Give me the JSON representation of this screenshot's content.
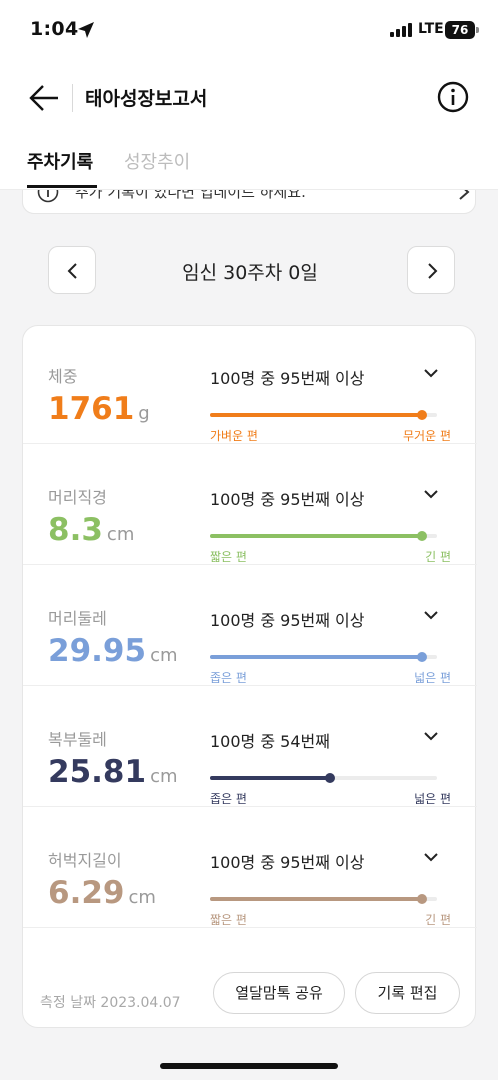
{
  "status_bar": {
    "time": "1:04",
    "network": "LTE",
    "battery": "76"
  },
  "header": {
    "title": "태아성장보고서"
  },
  "tabs": [
    {
      "label": "주차기록",
      "active": true
    },
    {
      "label": "성장추이",
      "active": false
    }
  ],
  "notice": {
    "text": "추가 기록이 있다면 업데이트 하세요."
  },
  "week_nav": {
    "label": "임신 30주차 0일"
  },
  "metrics": [
    {
      "name": "체중",
      "value": "1761",
      "unit": "g",
      "rank": "100명 중 95번째 이상",
      "percentile": 95,
      "color": "#f07d1a",
      "low_label": "가벼운 편",
      "high_label": "무거운 편"
    },
    {
      "name": "머리직경",
      "value": "8.3",
      "unit": "cm",
      "rank": "100명 중 95번째 이상",
      "percentile": 95,
      "color": "#8cc063",
      "low_label": "짧은 편",
      "high_label": "긴 편"
    },
    {
      "name": "머리둘레",
      "value": "29.95",
      "unit": "cm",
      "rank": "100명 중 95번째 이상",
      "percentile": 95,
      "color": "#7a9fd9",
      "low_label": "좁은 편",
      "high_label": "넓은 편"
    },
    {
      "name": "복부둘레",
      "value": "25.81",
      "unit": "cm",
      "rank": "100명 중 54번째",
      "percentile": 54,
      "color": "#343a5e",
      "low_label": "좁은 편",
      "high_label": "넓은 편"
    },
    {
      "name": "허벅지길이",
      "value": "6.29",
      "unit": "cm",
      "rank": "100명 중 95번째 이상",
      "percentile": 95,
      "color": "#b89880",
      "low_label": "짧은 편",
      "high_label": "긴 편"
    }
  ],
  "footer": {
    "measure_date": "측정 날짜 2023.04.07",
    "share_label": "열달맘톡 공유",
    "edit_label": "기록 편집"
  }
}
